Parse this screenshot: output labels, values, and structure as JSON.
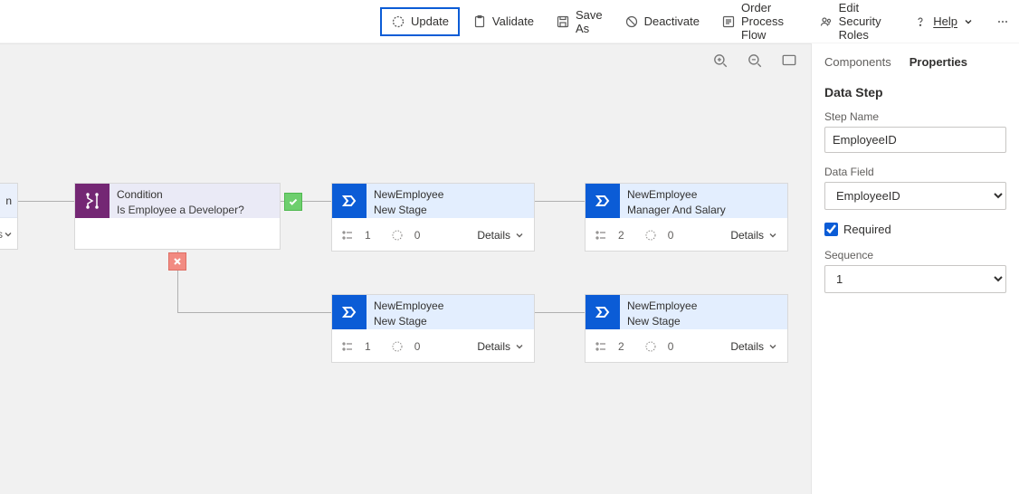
{
  "toolbar": {
    "update": "Update",
    "validate": "Validate",
    "save_as": "Save As",
    "deactivate": "Deactivate",
    "order": "Order Process Flow",
    "security": "Edit Security Roles",
    "help": "Help"
  },
  "canvas": {
    "partial_tail": "n",
    "partial_details_suffix": "ls",
    "condition": {
      "title": "Condition",
      "subtitle": "Is Employee a Developer?"
    },
    "stages": {
      "top1": {
        "line1": "NewEmployee",
        "line2": "New Stage",
        "count1": "1",
        "count2": "0",
        "details": "Details"
      },
      "top2": {
        "line1": "NewEmployee",
        "line2": "Manager And Salary",
        "count1": "2",
        "count2": "0",
        "details": "Details"
      },
      "bottom1": {
        "line1": "NewEmployee",
        "line2": "New Stage",
        "count1": "1",
        "count2": "0",
        "details": "Details"
      },
      "bottom2": {
        "line1": "NewEmployee",
        "line2": "New Stage",
        "count1": "2",
        "count2": "0",
        "details": "Details"
      }
    }
  },
  "panel": {
    "tabs": {
      "components": "Components",
      "properties": "Properties"
    },
    "heading": "Data Step",
    "step_name_label": "Step Name",
    "step_name_value": "EmployeeID",
    "data_field_label": "Data Field",
    "data_field_value": "EmployeeID",
    "required_label": "Required",
    "sequence_label": "Sequence",
    "sequence_value": "1"
  }
}
